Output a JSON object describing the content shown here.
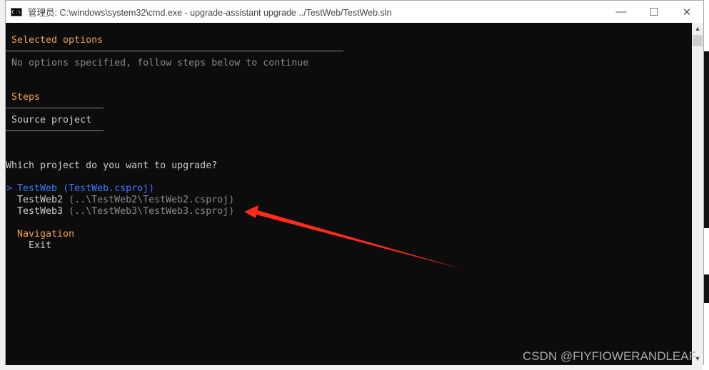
{
  "window": {
    "title": "管理员: C:\\windows\\system32\\cmd.exe - upgrade-assistant  upgrade ../TestWeb/TestWeb.sln",
    "minimize": "—",
    "maximize": "☐",
    "close": "✕"
  },
  "console": {
    "selected_header": "Selected options",
    "selected_text": "No options specified, follow steps below to continue",
    "steps_header": "Steps",
    "step_current": "Source project",
    "question": "Which project do you want to upgrade?",
    "cursor": ">",
    "projects": [
      {
        "name": "TestWeb",
        "path": "(TestWeb.csproj)"
      },
      {
        "name": "TestWeb2",
        "path": "(..\\TestWeb2\\TestWeb2.csproj)"
      },
      {
        "name": "TestWeb3",
        "path": "(..\\TestWeb3\\TestWeb3.csproj)"
      }
    ],
    "nav_header": "Navigation",
    "nav_exit": "Exit"
  },
  "colors": {
    "accent": "#f0a050",
    "selected": "#3b78ff",
    "annotation": "#ff2a1a"
  },
  "watermark": "CSDN @FIYFIOWERANDLEAF"
}
